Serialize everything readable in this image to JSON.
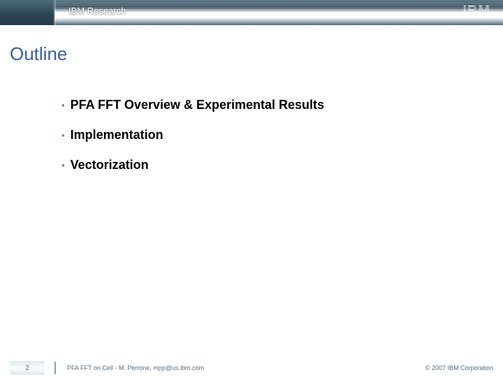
{
  "header": {
    "org": "IBM Research",
    "logo_text": "IBM"
  },
  "slide": {
    "title": "Outline",
    "bullets": [
      "PFA FFT Overview & Experimental Results",
      "Implementation",
      "Vectorization"
    ]
  },
  "footer": {
    "page": "2",
    "center": "PFA FFT on Cell - M. Perrone,  mpp@us.ibm.com",
    "right": "© 2007 IBM Corporation"
  }
}
